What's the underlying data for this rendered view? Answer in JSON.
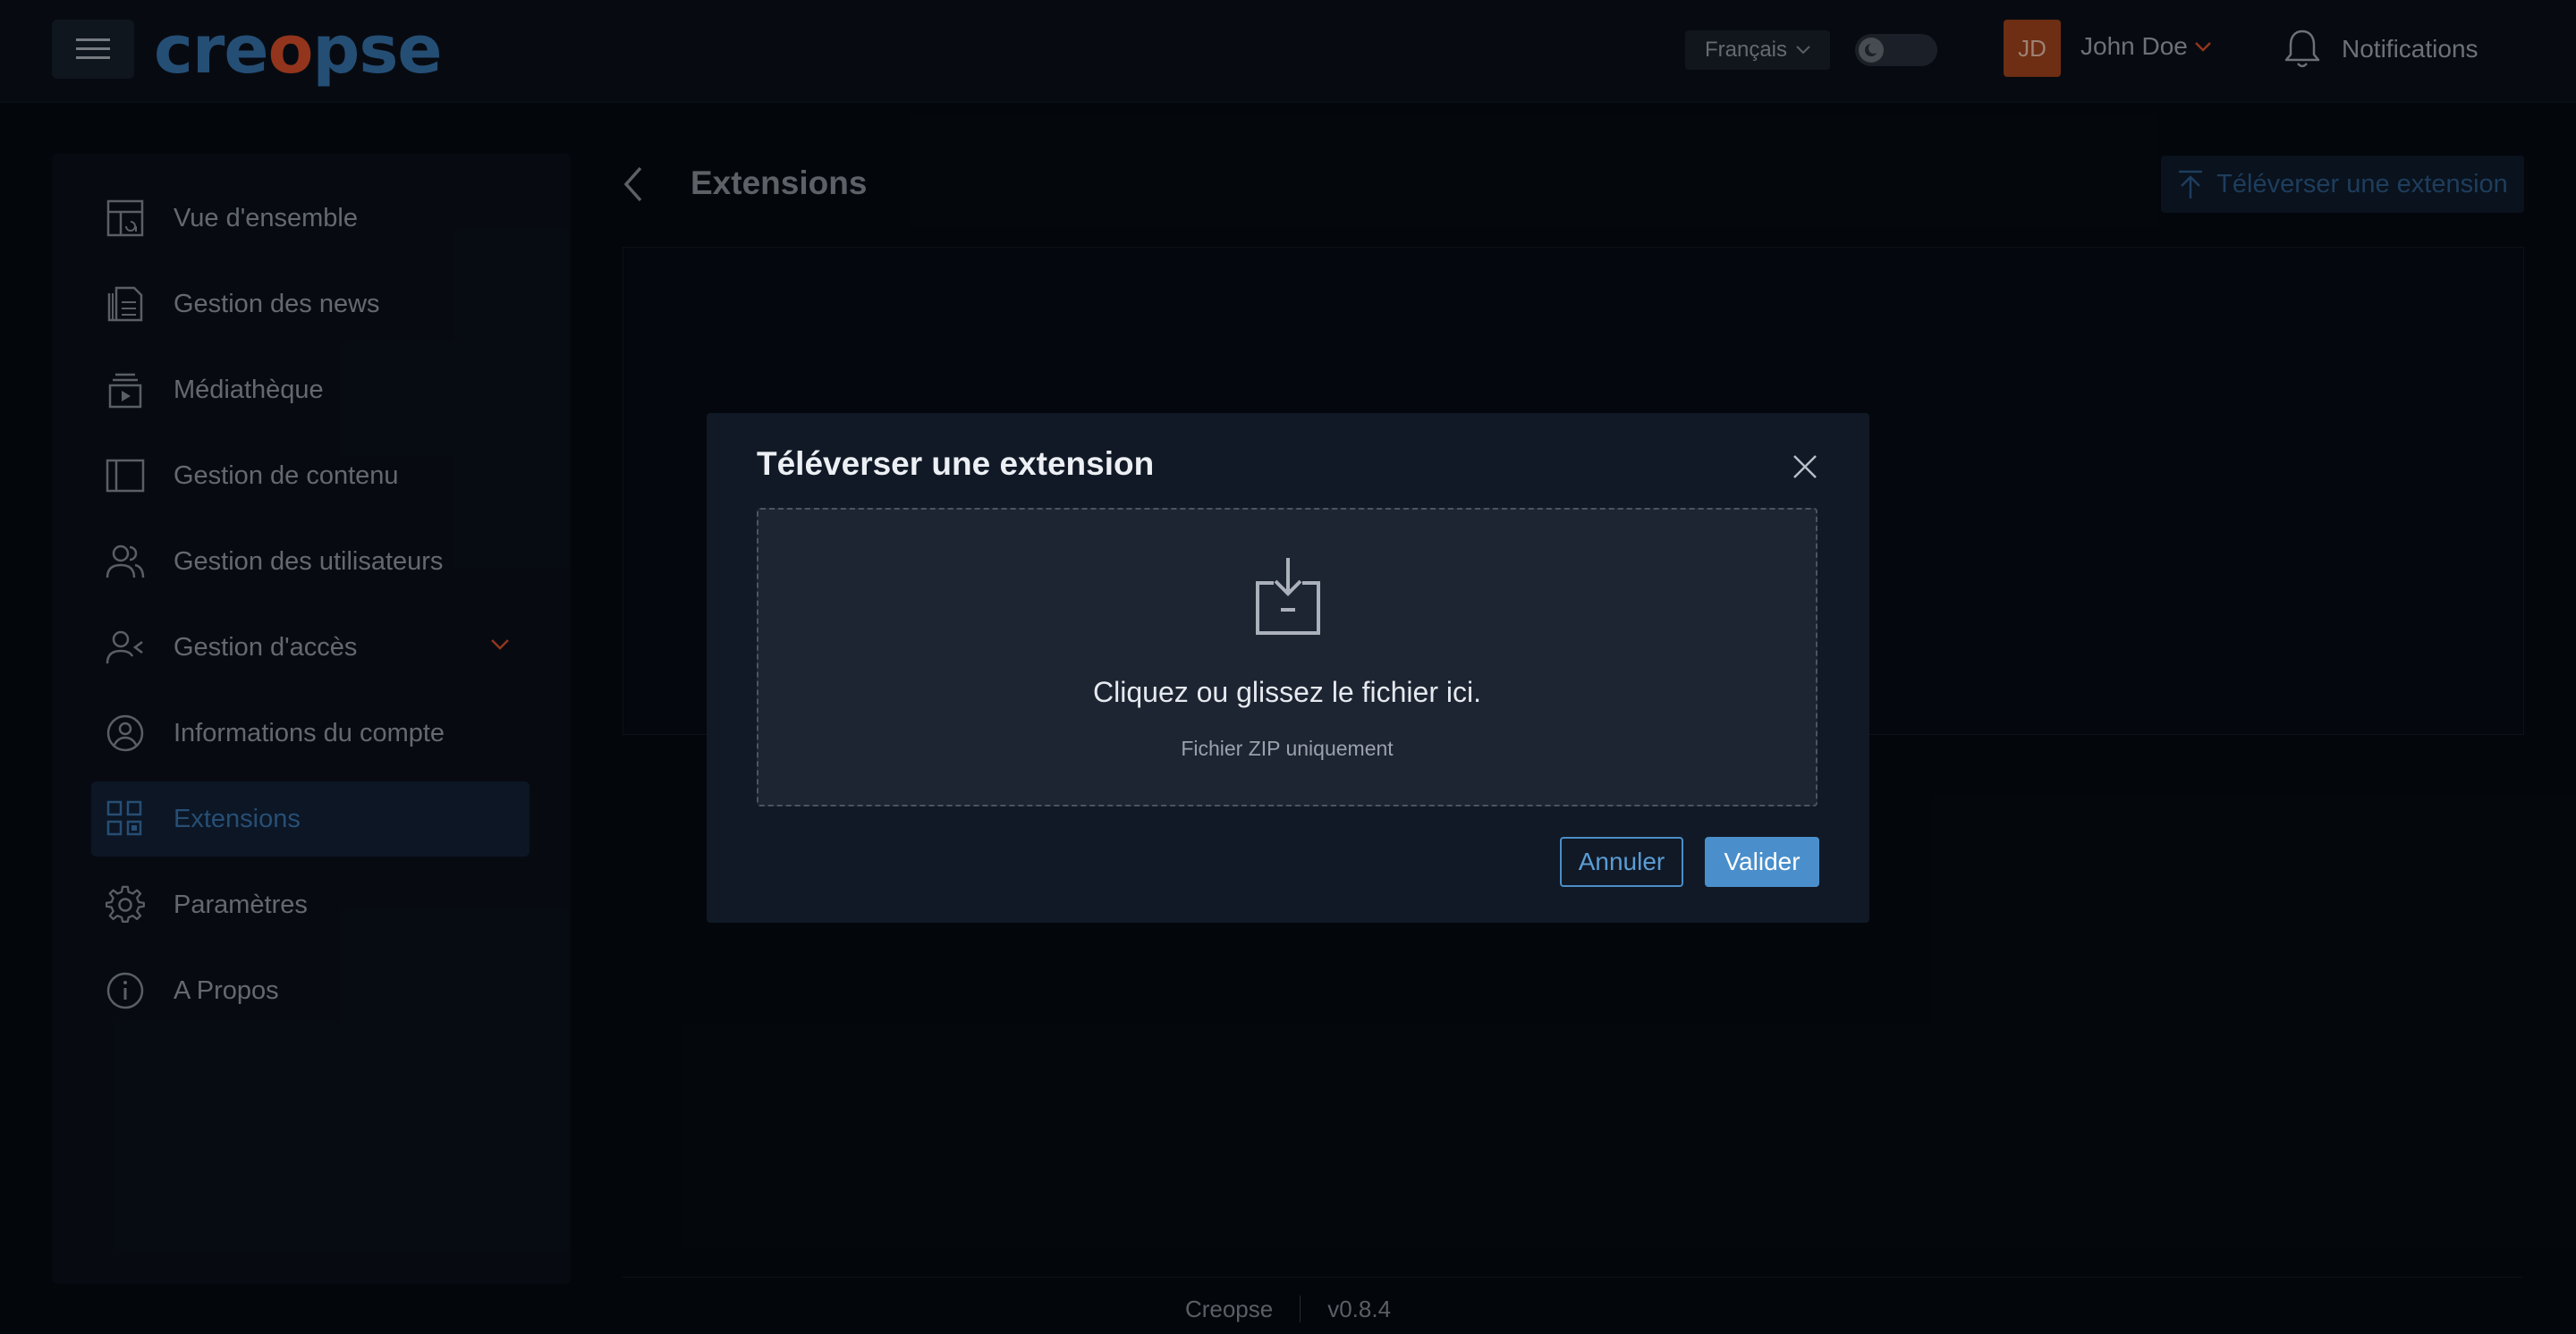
{
  "header": {
    "logo_text_a": "cre",
    "logo_text_o": "o",
    "logo_text_b": "pse",
    "language": "Français",
    "user_initials": "JD",
    "user_name": "John Doe",
    "notifications_label": "Notifications"
  },
  "sidebar": {
    "items": [
      {
        "label": "Vue d'ensemble",
        "icon": "dashboard-icon"
      },
      {
        "label": "Gestion des news",
        "icon": "news-icon"
      },
      {
        "label": "Médiathèque",
        "icon": "media-library-icon"
      },
      {
        "label": "Gestion de contenu",
        "icon": "layout-icon"
      },
      {
        "label": "Gestion des utilisateurs",
        "icon": "users-icon"
      },
      {
        "label": "Gestion d'accès",
        "icon": "user-access-icon"
      },
      {
        "label": "Informations du compte",
        "icon": "account-icon"
      },
      {
        "label": "Extensions",
        "icon": "extensions-icon"
      },
      {
        "label": "Paramètres",
        "icon": "settings-icon"
      },
      {
        "label": "A Propos",
        "icon": "info-icon"
      }
    ],
    "active": "Extensions"
  },
  "main": {
    "title": "Extensions",
    "upload_button": "Téléverser une extension"
  },
  "modal": {
    "title": "Téléverser une extension",
    "dropzone_text": "Cliquez ou glissez le fichier ici.",
    "dropzone_hint": "Fichier ZIP uniquement",
    "cancel_label": "Annuler",
    "submit_label": "Valider"
  },
  "footer": {
    "app_name": "Creopse",
    "version": "v0.8.4"
  },
  "colors": {
    "accent": "#4a8fcb",
    "brand": "#3a79b4",
    "brand_orange": "#e0522b",
    "background": "#060a12"
  }
}
